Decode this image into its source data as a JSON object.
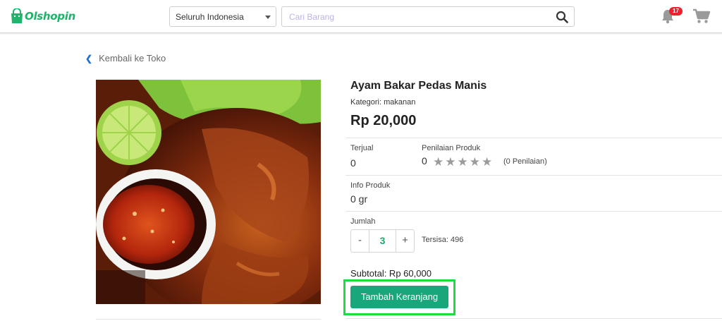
{
  "brand": {
    "name": "Olshopin",
    "color": "#1fb36b"
  },
  "header": {
    "region_selected": "Seluruh Indonesia",
    "search_placeholder": "Cari Barang",
    "search_icon": "search-icon",
    "notification_count": "17",
    "bell_icon": "bell-icon",
    "cart_icon": "cart-icon"
  },
  "nav": {
    "back_label": "Kembali ke Toko"
  },
  "product": {
    "image_alt": "Ayam Bakar Pedas Manis",
    "name": "Ayam Bakar Pedas Manis",
    "category": "Kategori: makanan",
    "price": "Rp 20,000",
    "sold_label": "Terjual",
    "sold_value": "0",
    "rating_label": "Penilaian Produk",
    "rating_value": "0",
    "rating_stars": 0,
    "rating_count": "(0 Penilaian)",
    "info_label": "Info Produk",
    "weight": "0 gr",
    "qty_label": "Jumlah",
    "qty_minus": "-",
    "qty_value": "3",
    "qty_plus": "+",
    "stock": "Tersisa: 496",
    "subtotal": "Subtotal: Rp 60,000",
    "add_to_cart": "Tambah Keranjang"
  },
  "colors": {
    "accent": "#17a77a",
    "highlight": "#1fdc3c",
    "badge": "#e8242f",
    "back_chevron": "#1f6fd6"
  }
}
